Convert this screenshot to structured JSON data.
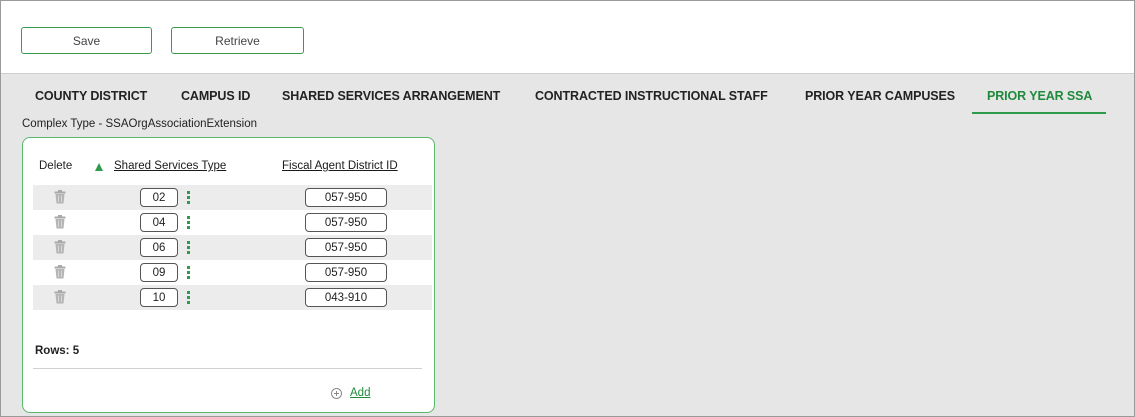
{
  "toolbar": {
    "save_label": "Save",
    "retrieve_label": "Retrieve"
  },
  "tabs": [
    {
      "label": "COUNTY DISTRICT",
      "active": false
    },
    {
      "label": "CAMPUS ID",
      "active": false
    },
    {
      "label": "SHARED SERVICES ARRANGEMENT",
      "active": false
    },
    {
      "label": "CONTRACTED INSTRUCTIONAL STAFF",
      "active": false
    },
    {
      "label": "PRIOR YEAR CAMPUSES",
      "active": false
    },
    {
      "label": "PRIOR YEAR SSA",
      "active": true
    }
  ],
  "complex_type": "Complex Type - SSAOrgAssociationExtension",
  "grid": {
    "headers": {
      "delete": "Delete",
      "shared_services_type": "Shared Services Type",
      "fiscal_agent_district_id": "Fiscal Agent District ID"
    },
    "rows": [
      {
        "shared_services_type": "02",
        "fiscal_agent_district_id": "057-950"
      },
      {
        "shared_services_type": "04",
        "fiscal_agent_district_id": "057-950"
      },
      {
        "shared_services_type": "06",
        "fiscal_agent_district_id": "057-950"
      },
      {
        "shared_services_type": "09",
        "fiscal_agent_district_id": "057-950"
      },
      {
        "shared_services_type": "10",
        "fiscal_agent_district_id": "043-910"
      }
    ],
    "rows_count": "Rows: 5",
    "add_label": "Add"
  },
  "colors": {
    "accent": "#2e9a4a",
    "active_tab": "#1f8a3c",
    "border": "#58b86c"
  },
  "icons": {
    "delete": "trash-icon",
    "sort": "sort-ascending-icon",
    "lookup": "kebab-menu-icon",
    "add": "add-circle-icon"
  }
}
